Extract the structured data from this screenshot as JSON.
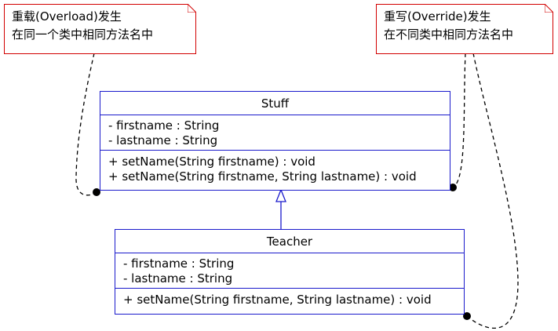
{
  "notes": [
    {
      "id": "overload",
      "lines": [
        "重载(Overload)发生",
        "在同一个类中相同方法名中"
      ]
    },
    {
      "id": "override",
      "lines": [
        "重写(Override)发生",
        "在不同类中相同方法名中"
      ]
    }
  ],
  "classes": {
    "stuff": {
      "name": "Stuff",
      "attributes": [
        "- firstname : String",
        "- lastname : String"
      ],
      "methods": [
        "+ setName(String firstname) : void",
        "+ setName(String firstname, String lastname) : void"
      ]
    },
    "teacher": {
      "name": "Teacher",
      "attributes": [
        "- firstname : String",
        "- lastname : String"
      ],
      "methods": [
        "+ setName(String firstname, String lastname) : void"
      ]
    }
  },
  "colors": {
    "class_border": "#1a1acc",
    "note_border": "#d20000",
    "connector": "#000000"
  }
}
